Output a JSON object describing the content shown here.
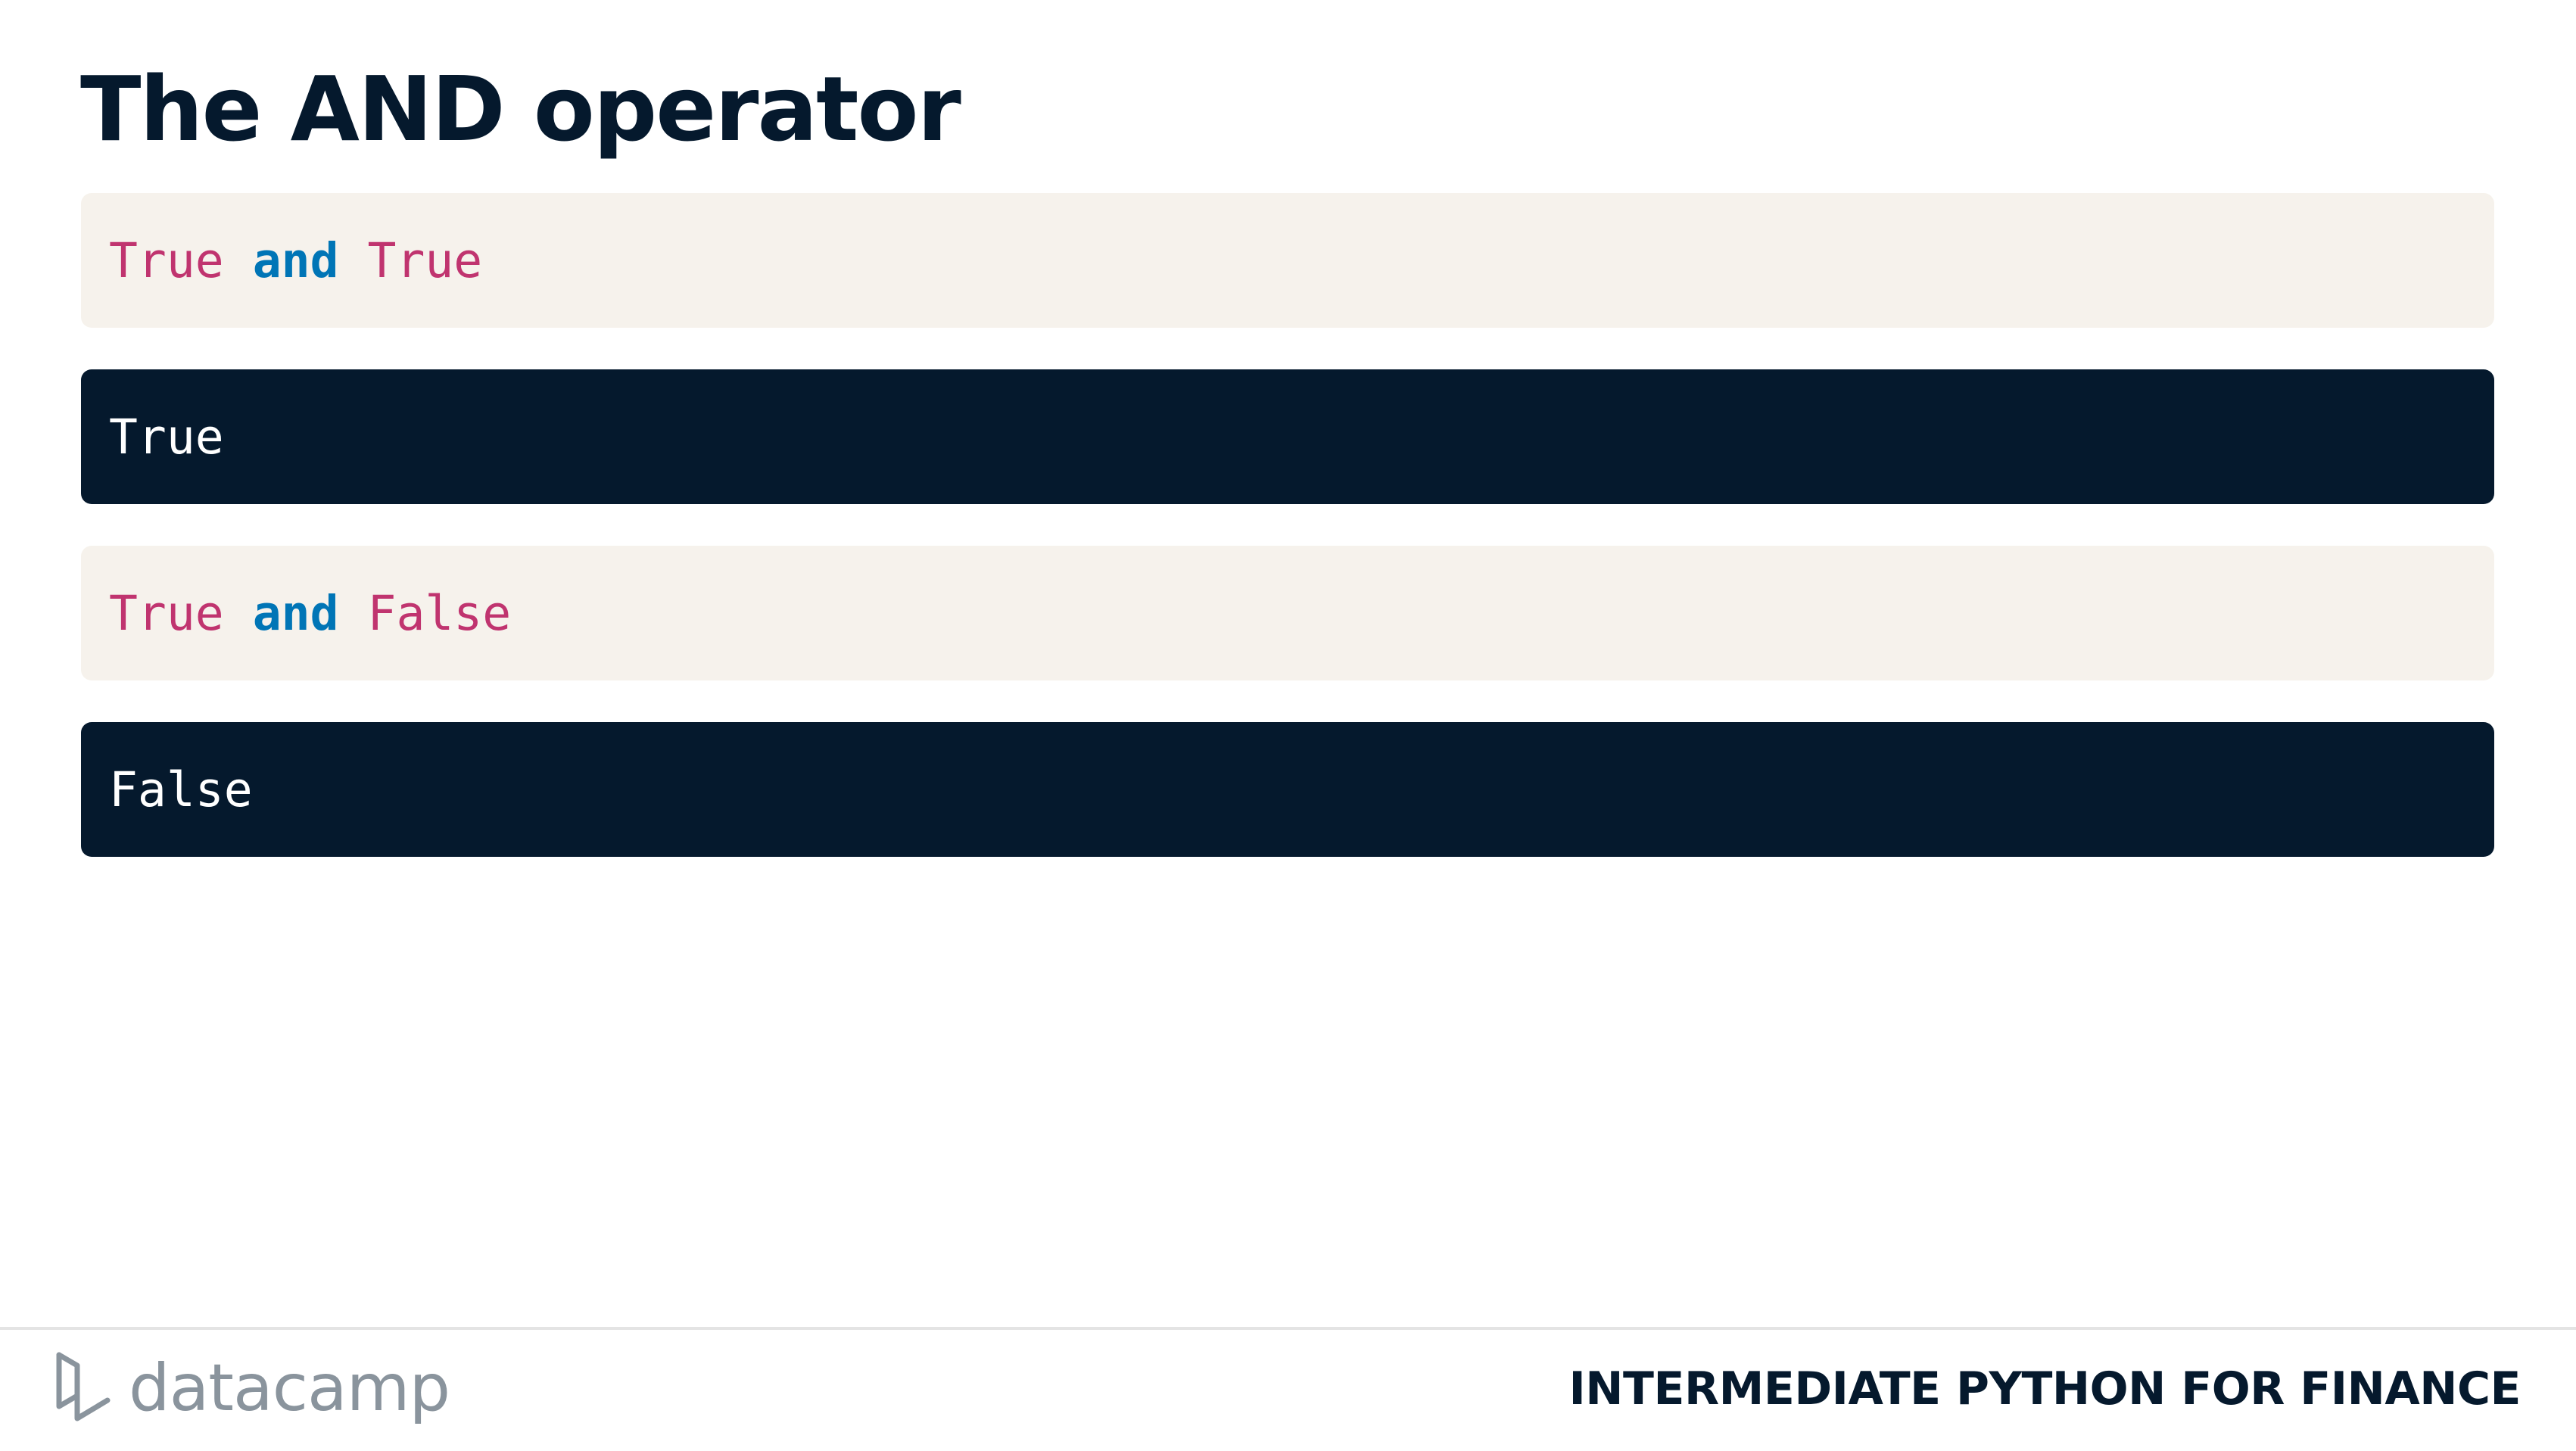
{
  "slide": {
    "title": "The AND operator"
  },
  "code_blocks": [
    {
      "kind": "input",
      "tokens": [
        {
          "text": "True",
          "type": "boolean"
        },
        {
          "text": "and",
          "type": "keyword"
        },
        {
          "text": "True",
          "type": "boolean"
        }
      ]
    },
    {
      "kind": "output",
      "text": "True"
    },
    {
      "kind": "input",
      "tokens": [
        {
          "text": "True",
          "type": "boolean"
        },
        {
          "text": "and",
          "type": "keyword"
        },
        {
          "text": "False",
          "type": "boolean"
        }
      ]
    },
    {
      "kind": "output",
      "text": "False"
    }
  ],
  "footer": {
    "logo_text": "datacamp",
    "course_title": "INTERMEDIATE PYTHON FOR FINANCE"
  },
  "colors": {
    "title": "#05192d",
    "input_background": "#f6f2ec",
    "output_background": "#05192d",
    "boolean_literal": "#c0346f",
    "keyword": "#0075b6",
    "logo": "#8a949d"
  },
  "icons": {
    "logo": "datacamp-logo-icon"
  }
}
